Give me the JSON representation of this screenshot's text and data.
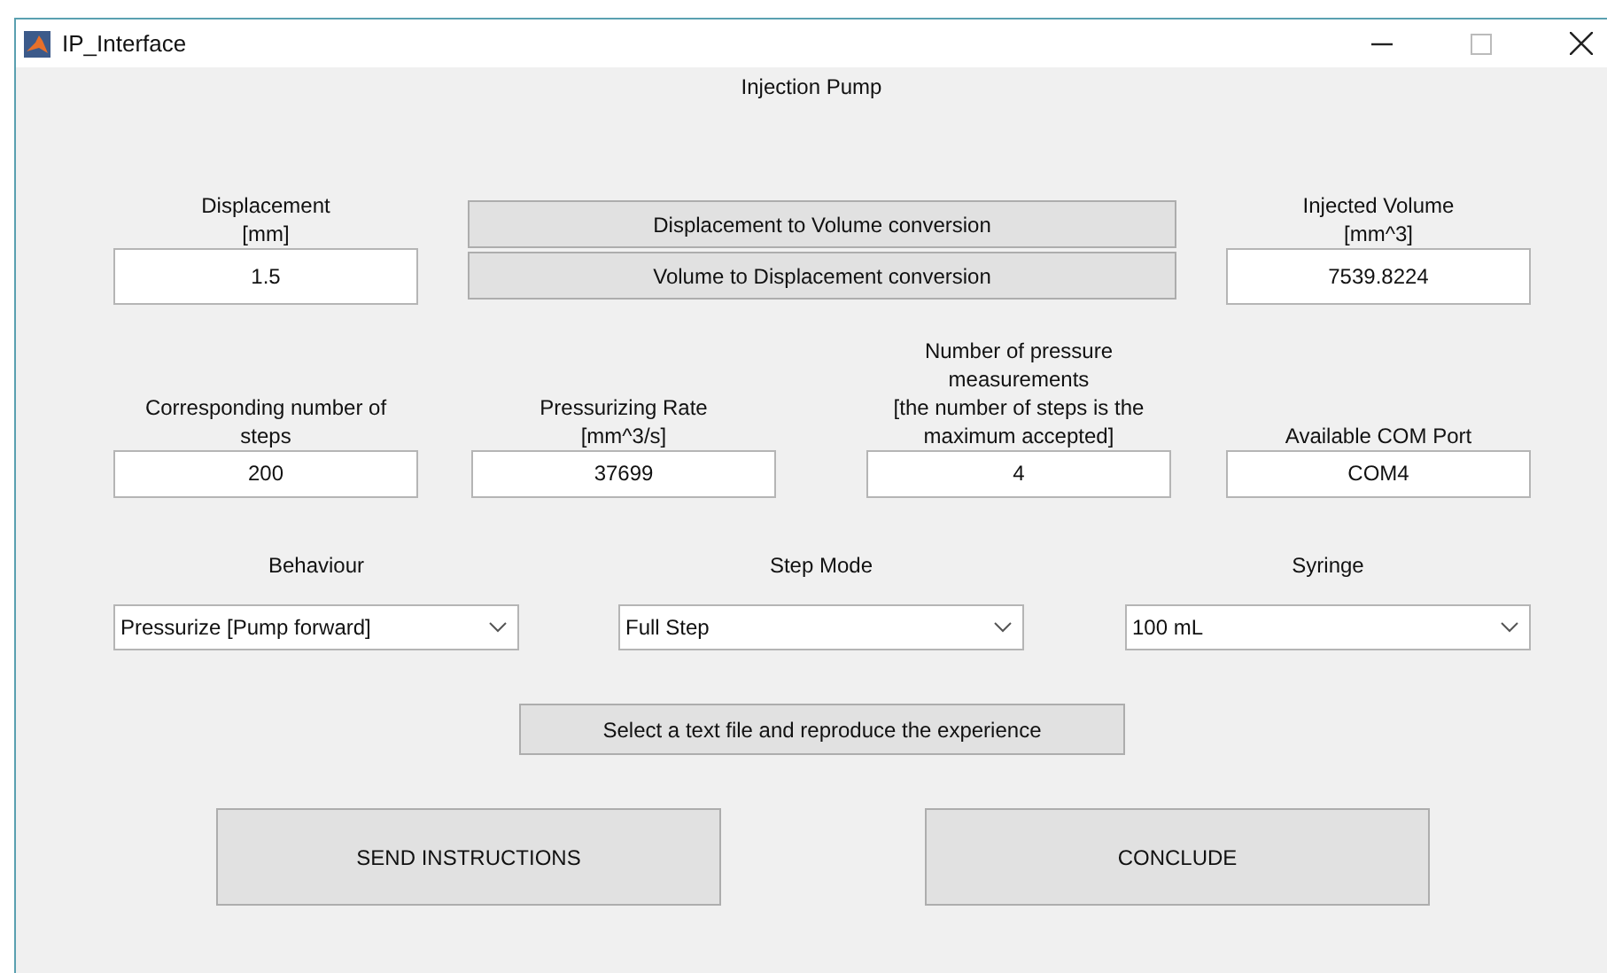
{
  "window": {
    "title": "IP_Interface"
  },
  "panel": {
    "title": "Injection Pump"
  },
  "conversion": {
    "left": {
      "label": "Displacement\n[mm]",
      "value": "1.5"
    },
    "buttons": [
      "Displacement to Volume conversion",
      "Volume to Displacement conversion"
    ],
    "right": {
      "label": "Injected Volume\n[mm^3]",
      "value": "7539.8224"
    }
  },
  "fields": [
    {
      "label": "Corresponding number of\nsteps",
      "value": "200"
    },
    {
      "label": "Pressurizing Rate\n[mm^3/s]",
      "value": "37699"
    },
    {
      "label": "Number of pressure\nmeasurements\n[the number of steps is the\nmaximum accepted]",
      "value": "4"
    },
    {
      "label": "Available COM Port",
      "value": "COM4"
    }
  ],
  "dropdowns": [
    {
      "label": "Behaviour",
      "value": "Pressurize [Pump forward]"
    },
    {
      "label": "Step Mode",
      "value": "Full Step"
    },
    {
      "label": "Syringe",
      "value": "100 mL"
    }
  ],
  "file_button": "Select a text file and reproduce the experience",
  "actions": [
    "SEND INSTRUCTIONS",
    "CONCLUDE"
  ]
}
